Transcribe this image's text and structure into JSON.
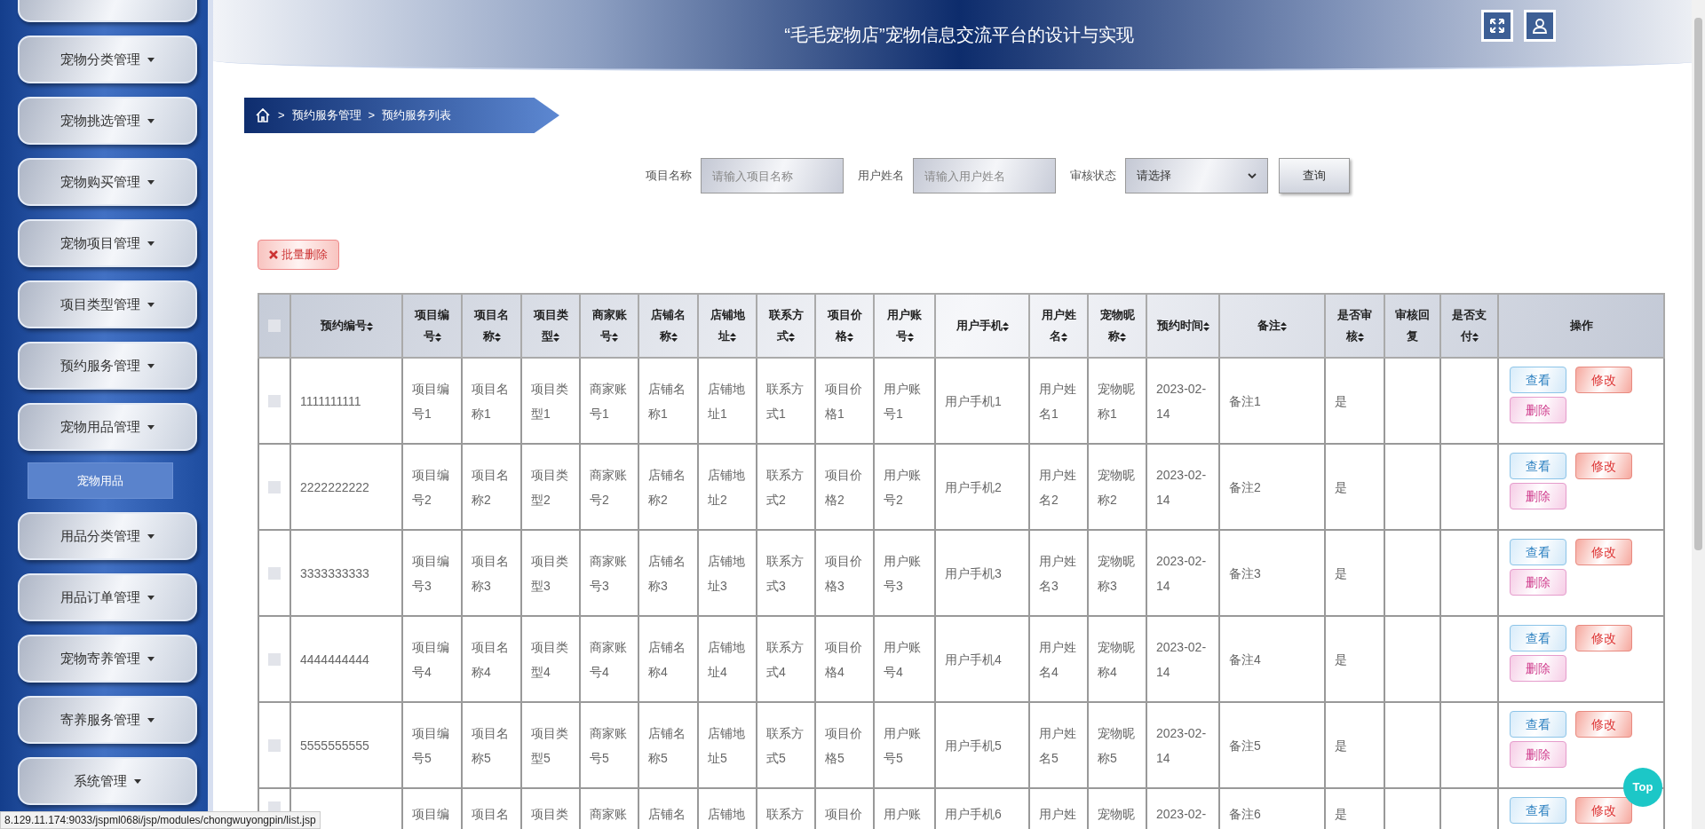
{
  "header": {
    "title": "“毛毛宠物店”宠物信息交流平台的设计与实现"
  },
  "sidebar": {
    "items": [
      {
        "kind": "clipped"
      },
      {
        "kind": "menu",
        "label": "宠物分类管理"
      },
      {
        "kind": "menu",
        "label": "宠物挑选管理"
      },
      {
        "kind": "menu",
        "label": "宠物购买管理"
      },
      {
        "kind": "menu",
        "label": "宠物项目管理"
      },
      {
        "kind": "menu",
        "label": "项目类型管理"
      },
      {
        "kind": "menu",
        "label": "预约服务管理"
      },
      {
        "kind": "menu",
        "label": "宠物用品管理",
        "children": [
          {
            "label": "宠物用品"
          }
        ]
      },
      {
        "kind": "menu",
        "label": "用品分类管理"
      },
      {
        "kind": "menu",
        "label": "用品订单管理"
      },
      {
        "kind": "menu",
        "label": "宠物寄养管理"
      },
      {
        "kind": "menu",
        "label": "寄养服务管理"
      },
      {
        "kind": "menu",
        "label": "系统管理"
      }
    ]
  },
  "breadcrumb": [
    {
      "separator": ">",
      "label": "预约服务管理"
    },
    {
      "separator": ">",
      "label": "预约服务列表"
    }
  ],
  "filters": [
    {
      "kind": "input",
      "label": "项目名称",
      "placeholder": "请输入项目名称"
    },
    {
      "kind": "input",
      "label": "用户姓名",
      "placeholder": "请输入用户姓名"
    },
    {
      "kind": "select",
      "label": "审核状态",
      "value": "请选择"
    }
  ],
  "search_button": "查询",
  "batch_delete_button": "批量删除",
  "table": {
    "select_all_checked": false,
    "columns": [
      {
        "label": "预约编号",
        "sortable": true
      },
      {
        "label": "项目编号",
        "sortable": true
      },
      {
        "label": "项目名称",
        "sortable": true
      },
      {
        "label": "项目类型",
        "sortable": true
      },
      {
        "label": "商家账号",
        "sortable": true
      },
      {
        "label": "店铺名称",
        "sortable": true
      },
      {
        "label": "店铺地址",
        "sortable": true
      },
      {
        "label": "联系方式",
        "sortable": true
      },
      {
        "label": "项目价格",
        "sortable": true
      },
      {
        "label": "用户账号",
        "sortable": true
      },
      {
        "label": "用户手机",
        "sortable": true
      },
      {
        "label": "用户姓名",
        "sortable": true
      },
      {
        "label": "宠物昵称",
        "sortable": true
      },
      {
        "label": "预约时间",
        "sortable": true
      },
      {
        "label": "备注",
        "sortable": true
      },
      {
        "label": "是否审核",
        "sortable": true
      },
      {
        "label": "审核回复",
        "sortable": false
      },
      {
        "label": "是否支付",
        "sortable": true
      },
      {
        "label": "操作",
        "sortable": false
      }
    ],
    "rows": [
      {
        "checked": false,
        "cells": [
          "1111111111",
          "项目编号1",
          "项目名称1",
          "项目类型1",
          "商家账号1",
          "店铺名称1",
          "店铺地址1",
          "联系方式1",
          "项目价格1",
          "用户账号1",
          "用户手机1",
          "用户姓名1",
          "宠物昵称1",
          "2023-02-14",
          "备注1",
          "是",
          "",
          ""
        ],
        "actions": [
          "查看",
          "修改",
          "删除"
        ]
      },
      {
        "checked": false,
        "cells": [
          "2222222222",
          "项目编号2",
          "项目名称2",
          "项目类型2",
          "商家账号2",
          "店铺名称2",
          "店铺地址2",
          "联系方式2",
          "项目价格2",
          "用户账号2",
          "用户手机2",
          "用户姓名2",
          "宠物昵称2",
          "2023-02-14",
          "备注2",
          "是",
          "",
          ""
        ],
        "actions": [
          "查看",
          "修改",
          "删除"
        ]
      },
      {
        "checked": false,
        "cells": [
          "3333333333",
          "项目编号3",
          "项目名称3",
          "项目类型3",
          "商家账号3",
          "店铺名称3",
          "店铺地址3",
          "联系方式3",
          "项目价格3",
          "用户账号3",
          "用户手机3",
          "用户姓名3",
          "宠物昵称3",
          "2023-02-14",
          "备注3",
          "是",
          "",
          ""
        ],
        "actions": [
          "查看",
          "修改",
          "删除"
        ]
      },
      {
        "checked": false,
        "cells": [
          "4444444444",
          "项目编号4",
          "项目名称4",
          "项目类型4",
          "商家账号4",
          "店铺名称4",
          "店铺地址4",
          "联系方式4",
          "项目价格4",
          "用户账号4",
          "用户手机4",
          "用户姓名4",
          "宠物昵称4",
          "2023-02-14",
          "备注4",
          "是",
          "",
          ""
        ],
        "actions": [
          "查看",
          "修改",
          "删除"
        ]
      },
      {
        "checked": false,
        "cells": [
          "5555555555",
          "项目编号5",
          "项目名称5",
          "项目类型5",
          "商家账号5",
          "店铺名称5",
          "店铺地址5",
          "联系方式5",
          "项目价格5",
          "用户账号5",
          "用户手机5",
          "用户姓名5",
          "宠物昵称5",
          "2023-02-14",
          "备注5",
          "是",
          "",
          ""
        ],
        "actions": [
          "查看",
          "修改",
          "删除"
        ]
      },
      {
        "checked": false,
        "cells": [
          "",
          "项目编",
          "项目名",
          "项目类",
          "商家账",
          "店铺名",
          "店铺地",
          "联系方",
          "项目价",
          "用户账",
          "用户手机6",
          "用户姓",
          "宠物昵",
          "2023-02-",
          "备注6",
          "是",
          "",
          ""
        ],
        "actions": [
          "查看",
          "修改"
        ]
      }
    ]
  },
  "top_button": "Top",
  "status_bar": "8.129.11.174:9033/jspml068i/jsp/modules/chongwuyongpin/list.jsp"
}
